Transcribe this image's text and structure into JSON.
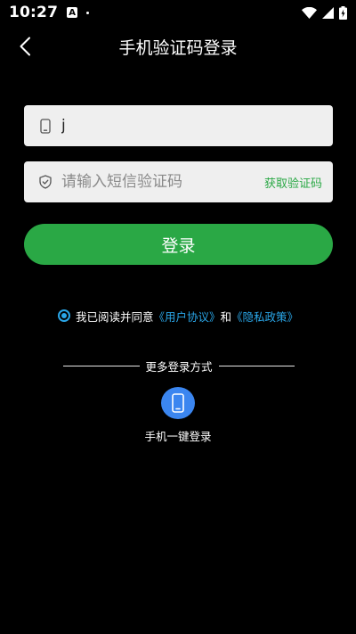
{
  "status_bar": {
    "time": "10:27",
    "notification_glyph": "A",
    "icons": [
      "notification-icon",
      "dot-icon",
      "wifi-icon",
      "signal-icon",
      "battery-charging-icon"
    ]
  },
  "header": {
    "title": "手机验证码登录",
    "back_icon": "back-arrow-icon"
  },
  "phone_field": {
    "value": "j",
    "icon": "phone-icon"
  },
  "code_field": {
    "placeholder": "请输入短信验证码",
    "icon": "shield-icon",
    "get_code_label": "获取验证码"
  },
  "login_button": {
    "label": "登录"
  },
  "agreement": {
    "checked": true,
    "prefix": "我已阅读并同意",
    "user_agreement": "《用户协议》",
    "conjunction": "和",
    "privacy_policy": "《隐私政策》"
  },
  "more_login": {
    "title": "更多登录方式",
    "one_click_label": "手机一键登录",
    "icon": "mobile-phone-icon"
  },
  "colors": {
    "accent_green": "#2aa845",
    "link_blue": "#2aa6e8",
    "icon_blue": "#3b86f0",
    "field_bg": "#efefef",
    "background": "#000000"
  }
}
